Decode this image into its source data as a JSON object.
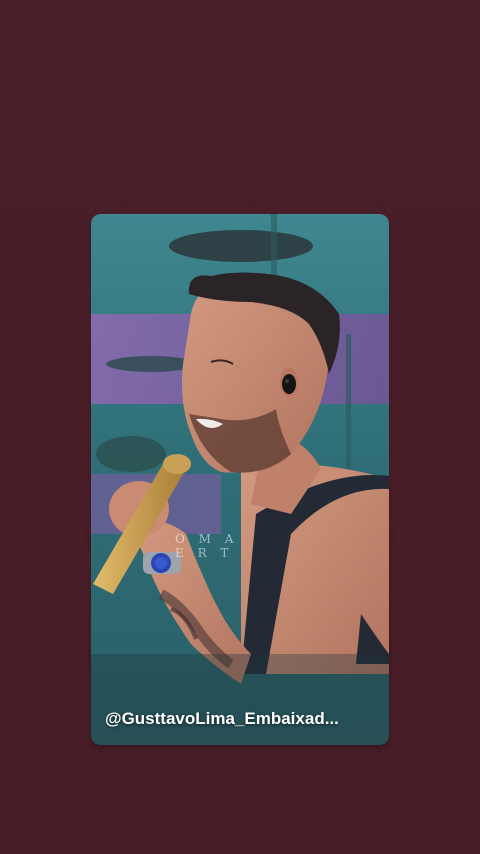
{
  "story": {
    "mention_handle": "@GusttavoLima_Embaixad...",
    "background_letters_line1": "O M A",
    "background_letters_line2": "E R T"
  },
  "colors": {
    "page_background": "#4a1f29",
    "card_teal": "#3a7f86",
    "stage_purple": "#8a5aa8",
    "skin": "#c48a72",
    "hair": "#2a2426",
    "microphone_gold": "#c9a055",
    "tank_top": "#232a36",
    "handle_text": "#ffffff"
  },
  "icons": [
    "earpiece-icon",
    "watch-icon",
    "microphone-icon"
  ]
}
